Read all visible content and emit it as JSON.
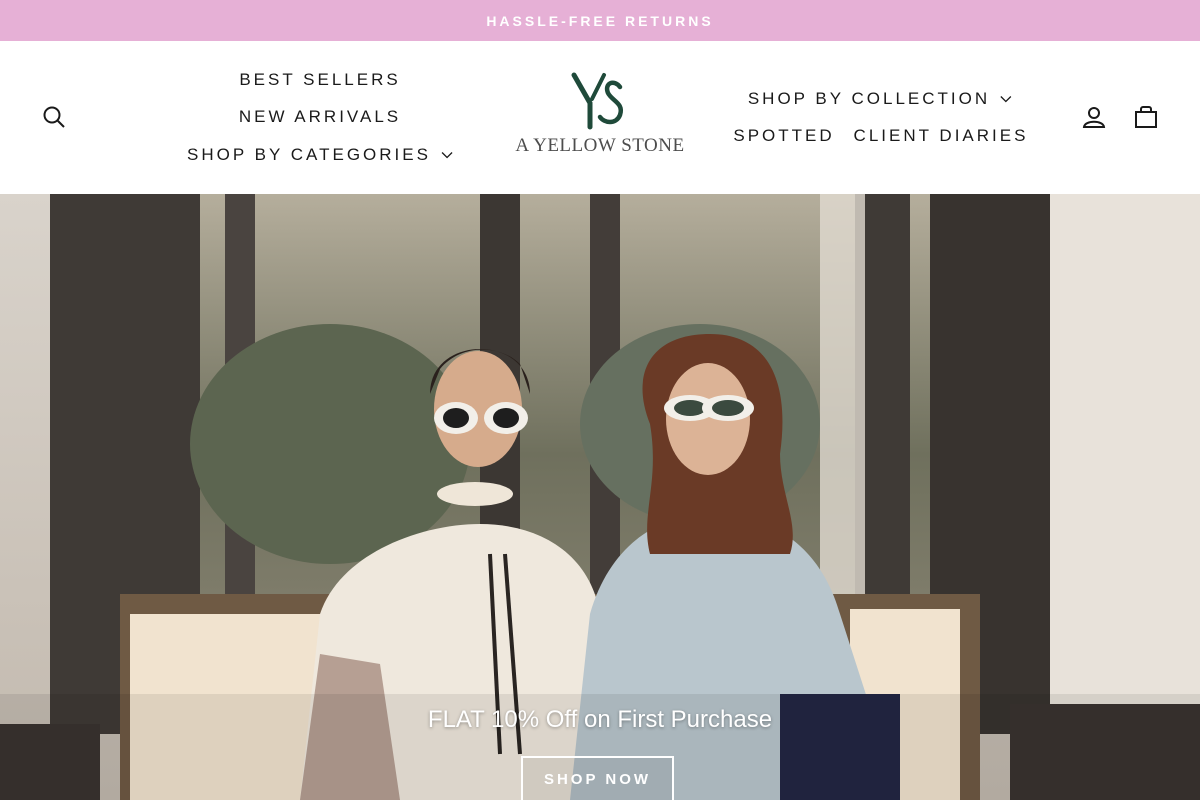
{
  "colors": {
    "announcement_bg": "#e6b0d6",
    "brand_green": "#1f4a3a",
    "text_dark": "#1a1a1a"
  },
  "announcement": {
    "text": "HASSLE-FREE RETURNS"
  },
  "header": {
    "logo_text": "A YELLOW STONE",
    "logo_monogram": "YS",
    "nav_left": [
      {
        "label": "BEST SELLERS",
        "dropdown": false
      },
      {
        "label": "NEW ARRIVALS",
        "dropdown": false
      },
      {
        "label": "SHOP BY CATEGORIES",
        "dropdown": true
      }
    ],
    "nav_right": [
      {
        "label": "SHOP BY COLLECTION",
        "dropdown": true
      },
      {
        "label": "SPOTTED",
        "dropdown": false
      },
      {
        "label": "CLIENT DIARIES",
        "dropdown": false
      }
    ],
    "icons": {
      "search": "search-icon",
      "account": "user-icon",
      "cart": "shopping-bag-icon"
    }
  },
  "hero": {
    "headline": "FLAT 10% Off on First Purchase",
    "cta_label": "SHOP NOW"
  }
}
